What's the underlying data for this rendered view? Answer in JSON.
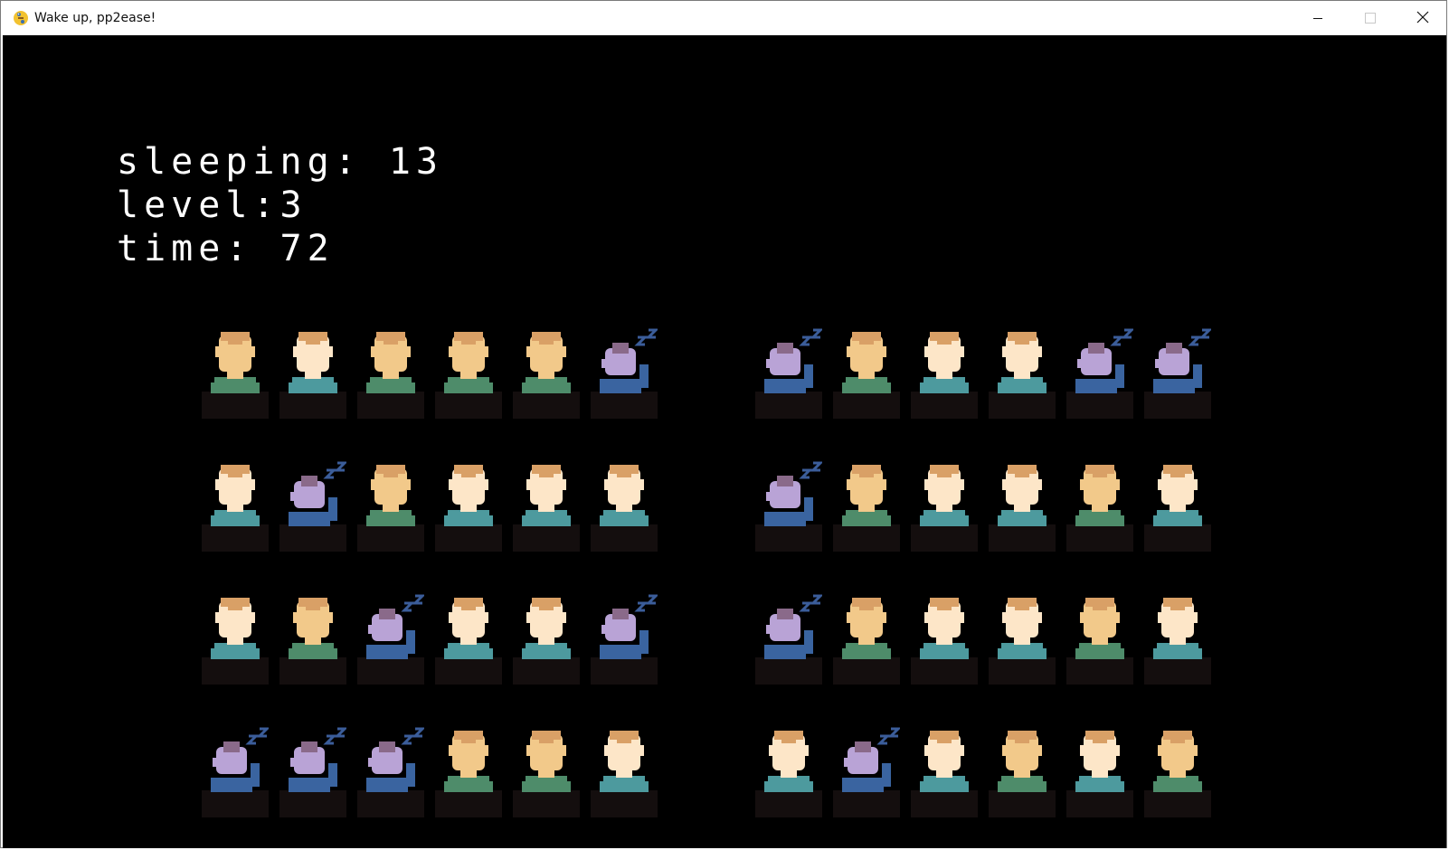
{
  "window": {
    "title": "Wake up, pp2ease!",
    "app_icon": "python-snake-icon",
    "controls": [
      "minimize-icon",
      "maximize-icon",
      "close-icon"
    ]
  },
  "hud": {
    "sleeping_label": "sleeping:",
    "sleeping_value": "13",
    "level_label": "level:",
    "level_value": "3",
    "time_label": "time:",
    "time_value": "72"
  },
  "colors": {
    "background": "#000000",
    "desk": "#140e0e",
    "skin_light": "#fde6c8",
    "skin_tan": "#f2c98a",
    "hair": "#d9a066",
    "shirt_teal": "#4d9a9e",
    "shirt_green": "#4e8c6a",
    "sleeper_head": "#b9a3d6",
    "sleeper_hair": "#8a6a8a",
    "sleeper_shirt": "#3a64a0",
    "zzz": "#3b5d9a"
  },
  "classroom": {
    "groups": [
      {
        "rows": [
          [
            "awake-tan-green",
            "awake-light-teal",
            "awake-tan-green",
            "awake-tan-green",
            "awake-tan-green",
            "sleeping"
          ],
          [
            "awake-light-teal",
            "sleeping",
            "awake-tan-green",
            "awake-light-teal",
            "awake-light-teal",
            "awake-light-teal"
          ],
          [
            "awake-light-teal",
            "awake-tan-green",
            "sleeping",
            "awake-light-teal",
            "awake-light-teal",
            "sleeping"
          ],
          [
            "sleeping",
            "sleeping",
            "sleeping",
            "awake-tan-green",
            "awake-tan-green",
            "awake-light-teal"
          ]
        ]
      },
      {
        "rows": [
          [
            "sleeping",
            "awake-tan-green",
            "awake-light-teal",
            "awake-light-teal",
            "sleeping",
            "sleeping"
          ],
          [
            "sleeping",
            "awake-tan-green",
            "awake-light-teal",
            "awake-light-teal",
            "awake-tan-green",
            "awake-light-teal"
          ],
          [
            "sleeping",
            "awake-tan-green",
            "awake-light-teal",
            "awake-light-teal",
            "awake-tan-green",
            "awake-light-teal"
          ],
          [
            "awake-light-teal",
            "sleeping",
            "awake-light-teal",
            "awake-tan-green",
            "awake-light-teal",
            "awake-tan-green"
          ]
        ]
      }
    ]
  }
}
